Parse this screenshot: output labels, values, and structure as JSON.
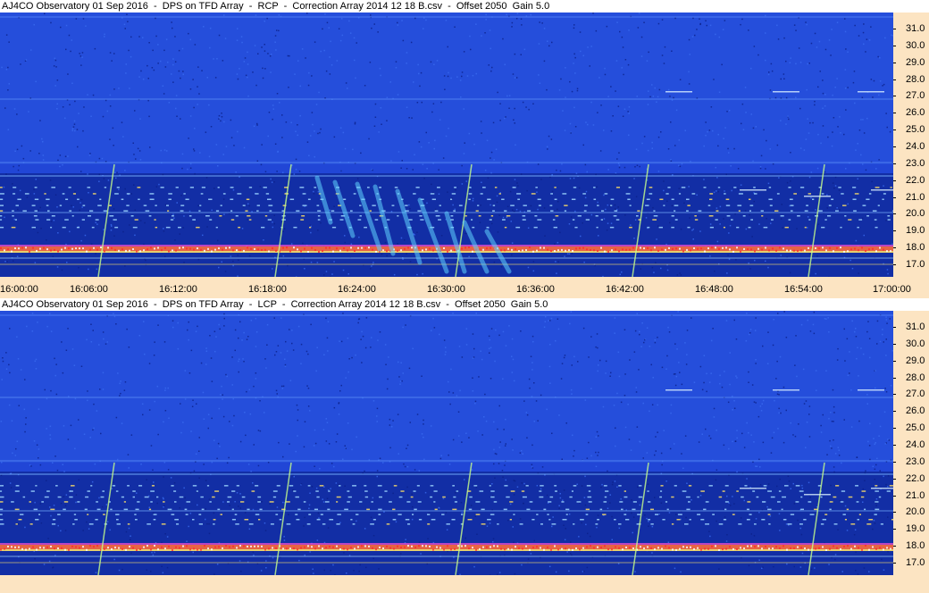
{
  "panels": [
    {
      "id": "rcp",
      "title": "AJ4CO Observatory 01 Sep 2016  -  DPS on TFD Array  -  RCP  -  Correction Array 2014 12 18 B.csv  -  Offset 2050  Gain 5.0"
    },
    {
      "id": "lcp",
      "title": "AJ4CO Observatory 01 Sep 2016  -  DPS on TFD Array  -  LCP  -  Correction Array 2014 12 18 B.csv  -  Offset 2050  Gain 5.0"
    }
  ],
  "frequency_ticks": [
    "31.0",
    "30.0",
    "29.0",
    "28.0",
    "27.0",
    "26.0",
    "25.0",
    "24.0",
    "23.0",
    "22.0",
    "21.0",
    "20.0",
    "19.0",
    "18.0",
    "17.0"
  ],
  "time_ticks": [
    "16:00:00",
    "16:06:00",
    "16:12:00",
    "16:18:00",
    "16:24:00",
    "16:30:00",
    "16:36:00",
    "16:42:00",
    "16:48:00",
    "16:54:00",
    "17:00:00"
  ],
  "colors": {
    "background_blue": "#1f3ed0",
    "dark_band_blue": "#0e1f8c",
    "interference_band": "#ff6a3a",
    "axis_background": "#fce4c2",
    "title_background": "#ffffff"
  }
}
